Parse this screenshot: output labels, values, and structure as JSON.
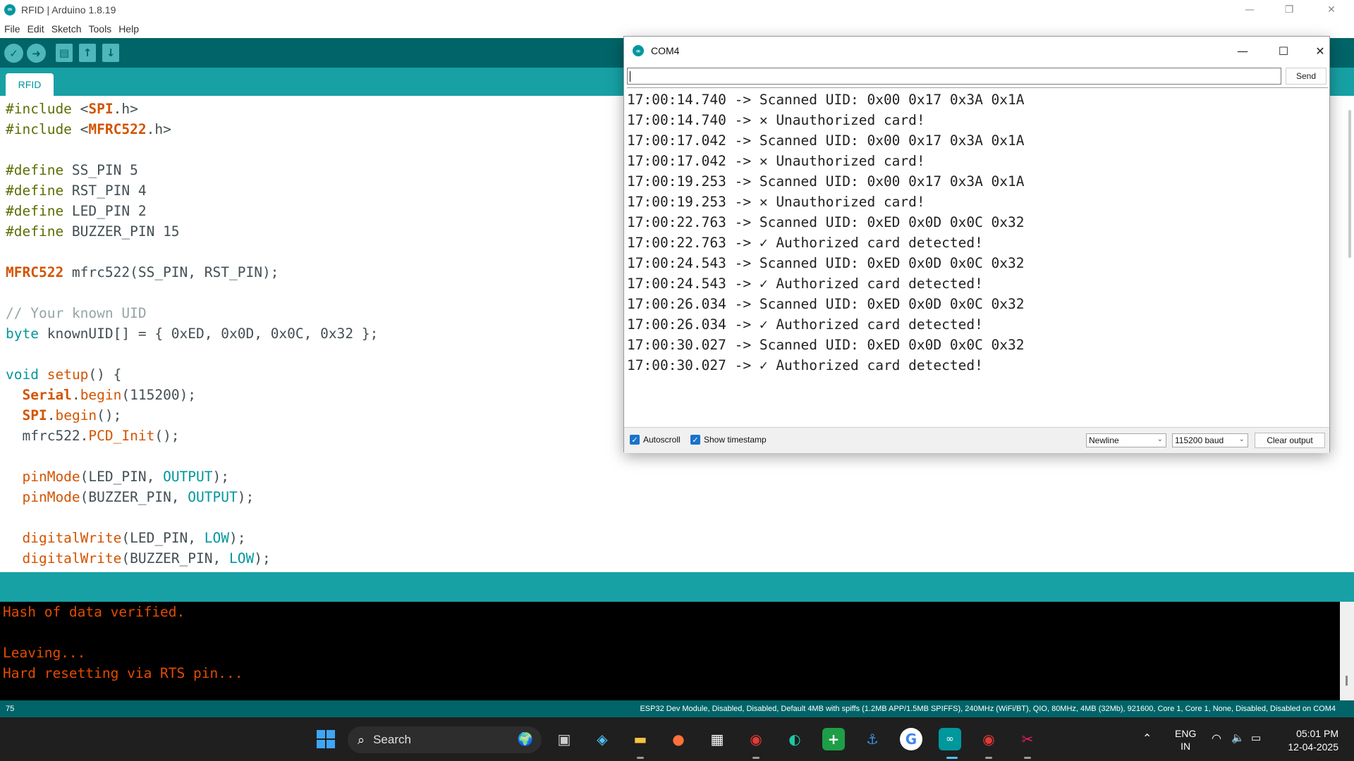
{
  "window": {
    "title": "RFID | Arduino 1.8.19"
  },
  "menu": [
    "File",
    "Edit",
    "Sketch",
    "Tools",
    "Help"
  ],
  "tab": {
    "label": "RFID"
  },
  "code_lines": [
    [
      {
        "t": "#include",
        "c": "kw-pp"
      },
      {
        "t": " <"
      },
      {
        "t": "SPI",
        "c": "kw-cls"
      },
      {
        "t": ".h>"
      }
    ],
    [
      {
        "t": "#include",
        "c": "kw-pp"
      },
      {
        "t": " <"
      },
      {
        "t": "MFRC522",
        "c": "kw-cls"
      },
      {
        "t": ".h>"
      }
    ],
    [],
    [
      {
        "t": "#define",
        "c": "kw-pp"
      },
      {
        "t": " SS_PIN 5"
      }
    ],
    [
      {
        "t": "#define",
        "c": "kw-pp"
      },
      {
        "t": " RST_PIN 4"
      }
    ],
    [
      {
        "t": "#define",
        "c": "kw-pp"
      },
      {
        "t": " LED_PIN 2"
      }
    ],
    [
      {
        "t": "#define",
        "c": "kw-pp"
      },
      {
        "t": " BUZZER_PIN 15"
      }
    ],
    [],
    [
      {
        "t": "MFRC522",
        "c": "kw-cls"
      },
      {
        "t": " mfrc522(SS_PIN, RST_PIN);"
      }
    ],
    [],
    [
      {
        "t": "// Your known UID",
        "c": "kw-cmt"
      }
    ],
    [
      {
        "t": "byte",
        "c": "kw-type"
      },
      {
        "t": " knownUID[] = { 0xED, 0x0D, 0x0C, 0x32 };"
      }
    ],
    [],
    [
      {
        "t": "void",
        "c": "kw-type"
      },
      {
        "t": " "
      },
      {
        "t": "setup",
        "c": "kw-fn"
      },
      {
        "t": "() {"
      }
    ],
    [
      {
        "t": "  "
      },
      {
        "t": "Serial",
        "c": "kw-cls"
      },
      {
        "t": "."
      },
      {
        "t": "begin",
        "c": "kw-fn"
      },
      {
        "t": "(115200);"
      }
    ],
    [
      {
        "t": "  "
      },
      {
        "t": "SPI",
        "c": "kw-cls"
      },
      {
        "t": "."
      },
      {
        "t": "begin",
        "c": "kw-fn"
      },
      {
        "t": "();"
      }
    ],
    [
      {
        "t": "  mfrc522."
      },
      {
        "t": "PCD_Init",
        "c": "kw-fn"
      },
      {
        "t": "();"
      }
    ],
    [],
    [
      {
        "t": "  "
      },
      {
        "t": "pinMode",
        "c": "kw-fn"
      },
      {
        "t": "(LED_PIN, "
      },
      {
        "t": "OUTPUT",
        "c": "kw-const"
      },
      {
        "t": ");"
      }
    ],
    [
      {
        "t": "  "
      },
      {
        "t": "pinMode",
        "c": "kw-fn"
      },
      {
        "t": "(BUZZER_PIN, "
      },
      {
        "t": "OUTPUT",
        "c": "kw-const"
      },
      {
        "t": ");"
      }
    ],
    [],
    [
      {
        "t": "  "
      },
      {
        "t": "digitalWrite",
        "c": "kw-fn"
      },
      {
        "t": "(LED_PIN, "
      },
      {
        "t": "LOW",
        "c": "kw-const"
      },
      {
        "t": ");"
      }
    ],
    [
      {
        "t": "  "
      },
      {
        "t": "digitalWrite",
        "c": "kw-fn"
      },
      {
        "t": "(BUZZER_PIN, "
      },
      {
        "t": "LOW",
        "c": "kw-const"
      },
      {
        "t": ");"
      }
    ]
  ],
  "console_lines": [
    "Hash of data verified.",
    "",
    "Leaving...",
    "Hard resetting via RTS pin..."
  ],
  "status": {
    "line_number": "75",
    "board_info": "ESP32 Dev Module, Disabled, Disabled, Default 4MB with spiffs (1.2MB APP/1.5MB SPIFFS), 240MHz (WiFi/BT), QIO, 80MHz, 4MB (32Mb), 921600, Core 1, Core 1, None, Disabled, Disabled on COM4"
  },
  "serial_monitor": {
    "title": "COM4",
    "input_value": "",
    "send_label": "Send",
    "lines": [
      "17:00:14.740 -> Scanned UID: 0x00 0x17 0x3A 0x1A",
      "17:00:14.740 -> ✕ Unauthorized card!",
      "17:00:17.042 -> Scanned UID: 0x00 0x17 0x3A 0x1A",
      "17:00:17.042 -> ✕ Unauthorized card!",
      "17:00:19.253 -> Scanned UID: 0x00 0x17 0x3A 0x1A",
      "17:00:19.253 -> ✕ Unauthorized card!",
      "17:00:22.763 -> Scanned UID: 0xED 0x0D 0x0C 0x32",
      "17:00:22.763 -> ✓ Authorized card detected!",
      "17:00:24.543 -> Scanned UID: 0xED 0x0D 0x0C 0x32",
      "17:00:24.543 -> ✓ Authorized card detected!",
      "17:00:26.034 -> Scanned UID: 0xED 0x0D 0x0C 0x32",
      "17:00:26.034 -> ✓ Authorized card detected!",
      "17:00:30.027 -> Scanned UID: 0xED 0x0D 0x0C 0x32",
      "17:00:30.027 -> ✓ Authorized card detected!"
    ],
    "autoscroll_label": "Autoscroll",
    "autoscroll_checked": true,
    "timestamp_label": "Show timestamp",
    "timestamp_checked": true,
    "line_ending": "Newline",
    "baud": "115200 baud",
    "clear_label": "Clear output"
  },
  "taskbar": {
    "search_label": "Search",
    "lang_top": "ENG",
    "lang_bottom": "IN",
    "time": "05:01 PM",
    "date": "12-04-2025"
  },
  "colors": {
    "toolbar": "#006468",
    "tabstrip": "#17a1a5",
    "console_text": "#e34c00"
  }
}
